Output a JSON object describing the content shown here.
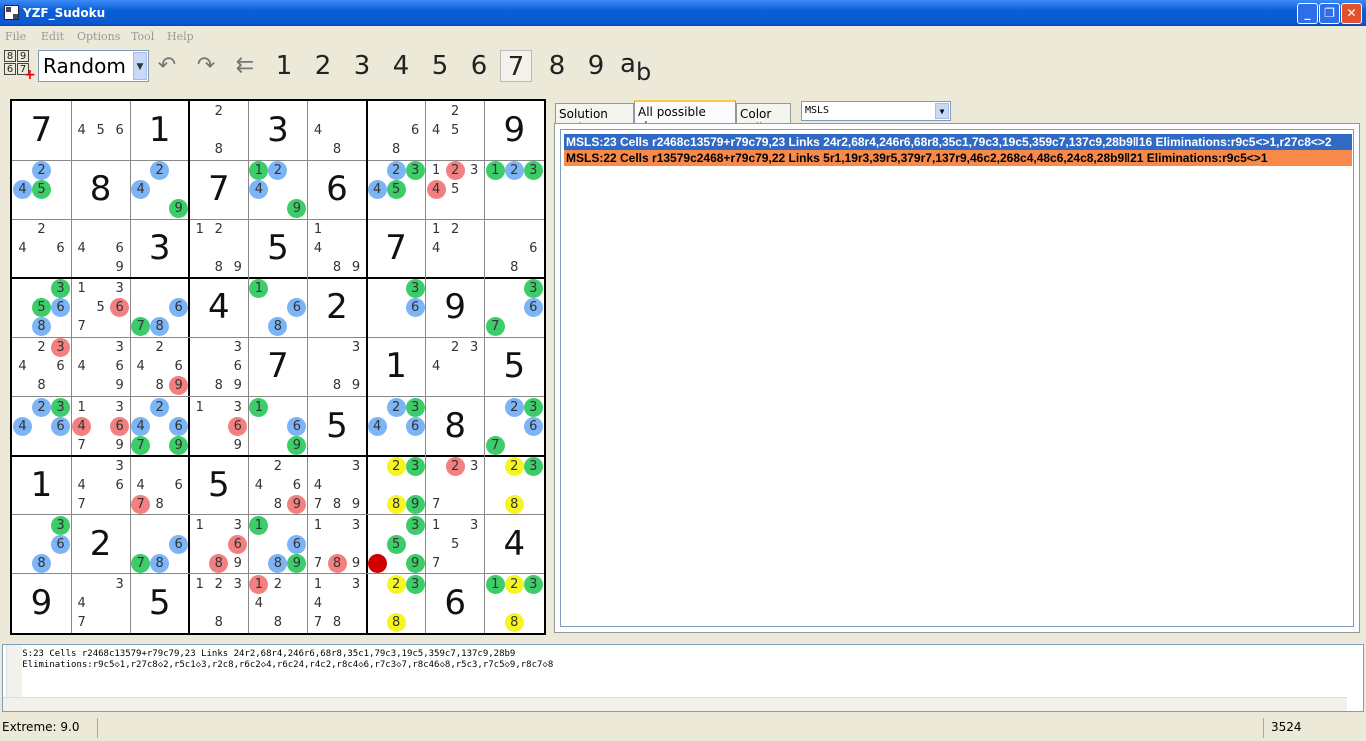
{
  "window": {
    "title": "YZF_Sudoku",
    "min_label": "_",
    "max_label": "❐",
    "close_label": "✕"
  },
  "menu": [
    "File",
    "Edit",
    "Options",
    "Tool",
    "Help"
  ],
  "toolbar": {
    "grid_icon_digits": [
      "8",
      "9",
      "6",
      "7"
    ],
    "difficulty": "Random",
    "icons": [
      "undo-icon",
      "redo-icon",
      "back-arrow-icon"
    ],
    "digits": [
      "1",
      "2",
      "3",
      "4",
      "5",
      "6",
      "7",
      "8",
      "9"
    ],
    "active_digit": "7",
    "ab_label": "a",
    "ab_sub": "b"
  },
  "colors": {
    "blue": "#7db4f5",
    "green": "#3dcc6a",
    "red": "#f28080",
    "yellow": "#f5f522",
    "dark_red": "#d00000",
    "selected_step": "#316ac5",
    "highlight_step": "#f7894a"
  },
  "tabs": [
    "Solution path",
    "All possible steps",
    "Color Cell"
  ],
  "active_tab": "All possible steps",
  "filter": "MSLS",
  "steps": [
    {
      "text": "MSLS:23 Cells r2468c13579+r79c79,23 Links 24r2,68r4,246r6,68r8,35c1,79c3,19c5,359c7,137c9,28b9ǁ16 Eliminations:r9c5<>1,r27c8<>2",
      "state": "selected"
    },
    {
      "text": "MSLS:22 Cells r13579c2468+r79c79,22 Links 5r1,19r3,39r5,379r7,137r9,46c2,268c4,48c6,24c8,28b9ǁ21 Eliminations:r9c5<>1",
      "state": "highlight"
    }
  ],
  "description": [
    "MSLS:23 Cells r2468c13579+r79c79,23 Links 24r2,68r4,246r6,68r8,35c1,79c3,19c5,359c7,137c9,28b9",
    "16 Eliminations:r9c5◇1,r27c8◇2,r5c1◇3,r2c8,r6c2◇4,r6c24,r4c2,r8c4◇6,r7c3◇7,r8c46◇8,r5c3,r7c5◇9,r8c7◇8"
  ],
  "status": {
    "left": "Extreme: 9.0",
    "right": "3524"
  },
  "board": [
    [
      {
        "v": "7"
      },
      {
        "c": [
          [
            "4",
            ""
          ],
          [
            "5",
            ""
          ],
          [
            "6",
            ""
          ]
        ]
      },
      {
        "v": "1"
      },
      {
        "c": [
          [
            "2",
            ""
          ],
          [
            "8",
            ""
          ]
        ]
      },
      {
        "v": "3"
      },
      {
        "c": [
          [
            "4",
            ""
          ],
          [
            "8",
            ""
          ]
        ]
      },
      {
        "c": [
          [
            "6",
            ""
          ],
          [
            "8",
            ""
          ]
        ]
      },
      {
        "c": [
          [
            "2",
            ""
          ],
          [
            "4",
            ""
          ],
          [
            "5",
            ""
          ]
        ]
      },
      {
        "v": "9"
      }
    ],
    [
      {
        "c": [
          [
            "2",
            "b"
          ],
          [
            "4",
            "b"
          ],
          [
            "5",
            "g"
          ]
        ]
      },
      {
        "v": "8"
      },
      {
        "c": [
          [
            "2",
            "b"
          ],
          [
            "4",
            "b"
          ],
          [
            "9",
            "g"
          ]
        ]
      },
      {
        "v": "7"
      },
      {
        "c": [
          [
            "1",
            "g"
          ],
          [
            "2",
            "b"
          ],
          [
            "4",
            "b"
          ],
          [
            "9",
            "g"
          ]
        ]
      },
      {
        "v": "6"
      },
      {
        "c": [
          [
            "2",
            "b"
          ],
          [
            "3",
            "g"
          ],
          [
            "4",
            "b"
          ],
          [
            "5",
            "g"
          ]
        ]
      },
      {
        "c": [
          [
            "1",
            ""
          ],
          [
            "2",
            "r"
          ],
          [
            "3",
            ""
          ],
          [
            "4",
            "r"
          ],
          [
            "5",
            ""
          ]
        ]
      },
      {
        "c": [
          [
            "1",
            "g"
          ],
          [
            "2",
            "b"
          ],
          [
            "3",
            "g"
          ]
        ]
      }
    ],
    [
      {
        "c": [
          [
            "2",
            ""
          ],
          [
            "4",
            ""
          ],
          [
            "6",
            ""
          ]
        ]
      },
      {
        "c": [
          [
            "4",
            ""
          ],
          [
            "6",
            ""
          ],
          [
            "9",
            ""
          ]
        ]
      },
      {
        "v": "3"
      },
      {
        "c": [
          [
            "1",
            ""
          ],
          [
            "2",
            ""
          ],
          [
            "8",
            ""
          ],
          [
            "9",
            ""
          ]
        ]
      },
      {
        "v": "5"
      },
      {
        "c": [
          [
            "1",
            ""
          ],
          [
            "4",
            ""
          ],
          [
            "8",
            ""
          ],
          [
            "9",
            ""
          ]
        ]
      },
      {
        "v": "7"
      },
      {
        "c": [
          [
            "1",
            ""
          ],
          [
            "2",
            ""
          ],
          [
            "4",
            ""
          ]
        ]
      },
      {
        "c": [
          [
            "6",
            ""
          ],
          [
            "8",
            ""
          ]
        ]
      }
    ],
    [
      {
        "c": [
          [
            "3",
            "g"
          ],
          [
            "5",
            "g"
          ],
          [
            "6",
            "b"
          ],
          [
            "8",
            "b"
          ]
        ]
      },
      {
        "c": [
          [
            "1",
            ""
          ],
          [
            "3",
            ""
          ],
          [
            "5",
            ""
          ],
          [
            "6",
            "r"
          ],
          [
            "7",
            ""
          ]
        ]
      },
      {
        "c": [
          [
            "6",
            "b"
          ],
          [
            "7",
            "g"
          ],
          [
            "8",
            "b"
          ]
        ]
      },
      {
        "v": "4"
      },
      {
        "c": [
          [
            "1",
            "g"
          ],
          [
            "6",
            "b"
          ],
          [
            "8",
            "b"
          ]
        ]
      },
      {
        "v": "2"
      },
      {
        "c": [
          [
            "3",
            "g"
          ],
          [
            "6",
            "b"
          ]
        ]
      },
      {
        "v": "9"
      },
      {
        "c": [
          [
            "3",
            "g"
          ],
          [
            "6",
            "b"
          ],
          [
            "7",
            "g"
          ]
        ]
      }
    ],
    [
      {
        "c": [
          [
            "2",
            ""
          ],
          [
            "3",
            "r"
          ],
          [
            "4",
            ""
          ],
          [
            "6",
            ""
          ],
          [
            "8",
            ""
          ]
        ]
      },
      {
        "c": [
          [
            "3",
            ""
          ],
          [
            "4",
            ""
          ],
          [
            "6",
            ""
          ],
          [
            "9",
            ""
          ]
        ]
      },
      {
        "c": [
          [
            "2",
            ""
          ],
          [
            "4",
            ""
          ],
          [
            "6",
            ""
          ],
          [
            "8",
            ""
          ],
          [
            "9",
            "r"
          ]
        ]
      },
      {
        "c": [
          [
            "3",
            ""
          ],
          [
            "6",
            ""
          ],
          [
            "8",
            ""
          ],
          [
            "9",
            ""
          ]
        ]
      },
      {
        "v": "7"
      },
      {
        "c": [
          [
            "3",
            ""
          ],
          [
            "8",
            ""
          ],
          [
            "9",
            ""
          ]
        ]
      },
      {
        "v": "1"
      },
      {
        "c": [
          [
            "2",
            ""
          ],
          [
            "3",
            ""
          ],
          [
            "4",
            ""
          ]
        ]
      },
      {
        "v": "5"
      }
    ],
    [
      {
        "c": [
          [
            "2",
            "b"
          ],
          [
            "3",
            "g"
          ],
          [
            "4",
            "b"
          ],
          [
            "6",
            "b"
          ]
        ]
      },
      {
        "c": [
          [
            "1",
            ""
          ],
          [
            "3",
            ""
          ],
          [
            "4",
            "r"
          ],
          [
            "6",
            "r"
          ],
          [
            "7",
            ""
          ],
          [
            "9",
            ""
          ]
        ]
      },
      {
        "c": [
          [
            "2",
            "b"
          ],
          [
            "4",
            "b"
          ],
          [
            "6",
            "b"
          ],
          [
            "7",
            "g"
          ],
          [
            "9",
            "g"
          ]
        ]
      },
      {
        "c": [
          [
            "1",
            ""
          ],
          [
            "3",
            ""
          ],
          [
            "6",
            "r"
          ],
          [
            "9",
            ""
          ]
        ]
      },
      {
        "c": [
          [
            "1",
            "g"
          ],
          [
            "6",
            "b"
          ],
          [
            "9",
            "g"
          ]
        ]
      },
      {
        "v": "5"
      },
      {
        "c": [
          [
            "2",
            "b"
          ],
          [
            "3",
            "g"
          ],
          [
            "4",
            "b"
          ],
          [
            "6",
            "b"
          ]
        ]
      },
      {
        "v": "8"
      },
      {
        "c": [
          [
            "2",
            "b"
          ],
          [
            "3",
            "g"
          ],
          [
            "6",
            "b"
          ],
          [
            "7",
            "g"
          ]
        ]
      }
    ],
    [
      {
        "v": "1"
      },
      {
        "c": [
          [
            "3",
            ""
          ],
          [
            "4",
            ""
          ],
          [
            "6",
            ""
          ],
          [
            "7",
            ""
          ]
        ]
      },
      {
        "c": [
          [
            "4",
            ""
          ],
          [
            "6",
            ""
          ],
          [
            "7",
            "r"
          ],
          [
            "8",
            ""
          ]
        ]
      },
      {
        "v": "5"
      },
      {
        "c": [
          [
            "2",
            ""
          ],
          [
            "4",
            ""
          ],
          [
            "6",
            ""
          ],
          [
            "8",
            ""
          ],
          [
            "9",
            "r"
          ]
        ]
      },
      {
        "c": [
          [
            "3",
            ""
          ],
          [
            "4",
            ""
          ],
          [
            "7",
            ""
          ],
          [
            "8",
            ""
          ],
          [
            "9",
            ""
          ]
        ]
      },
      {
        "c": [
          [
            "2",
            "y"
          ],
          [
            "3",
            "g"
          ],
          [
            "8",
            "y"
          ],
          [
            "9",
            "g"
          ]
        ]
      },
      {
        "c": [
          [
            "2",
            "r"
          ],
          [
            "3",
            ""
          ],
          [
            "7",
            ""
          ]
        ]
      },
      {
        "c": [
          [
            "2",
            "y"
          ],
          [
            "3",
            "g"
          ],
          [
            "8",
            "y"
          ]
        ]
      }
    ],
    [
      {
        "c": [
          [
            "3",
            "g"
          ],
          [
            "6",
            "b"
          ],
          [
            "8",
            "b"
          ]
        ]
      },
      {
        "v": "2"
      },
      {
        "c": [
          [
            "6",
            "b"
          ],
          [
            "7",
            "g"
          ],
          [
            "8",
            "b"
          ]
        ]
      },
      {
        "c": [
          [
            "1",
            ""
          ],
          [
            "3",
            ""
          ],
          [
            "6",
            "r"
          ],
          [
            "8",
            "r"
          ],
          [
            "9",
            ""
          ]
        ]
      },
      {
        "c": [
          [
            "1",
            "g"
          ],
          [
            "6",
            "b"
          ],
          [
            "8",
            "b"
          ],
          [
            "9",
            "g"
          ]
        ]
      },
      {
        "c": [
          [
            "1",
            ""
          ],
          [
            "3",
            ""
          ],
          [
            "7",
            ""
          ],
          [
            "8",
            "r"
          ],
          [
            "9",
            ""
          ]
        ]
      },
      {
        "c": [
          [
            "3",
            "g"
          ],
          [
            "5",
            "g"
          ],
          [
            "7",
            "d"
          ],
          [
            "9",
            "g"
          ]
        ]
      },
      {
        "c": [
          [
            "1",
            ""
          ],
          [
            "3",
            ""
          ],
          [
            "5",
            ""
          ],
          [
            "7",
            ""
          ]
        ]
      },
      {
        "v": "4"
      }
    ],
    [
      {
        "v": "9"
      },
      {
        "c": [
          [
            "3",
            ""
          ],
          [
            "4",
            ""
          ],
          [
            "7",
            ""
          ]
        ]
      },
      {
        "v": "5"
      },
      {
        "c": [
          [
            "1",
            ""
          ],
          [
            "2",
            ""
          ],
          [
            "3",
            ""
          ],
          [
            "8",
            ""
          ]
        ]
      },
      {
        "c": [
          [
            "1",
            "r"
          ],
          [
            "2",
            ""
          ],
          [
            "4",
            ""
          ],
          [
            "8",
            ""
          ]
        ]
      },
      {
        "c": [
          [
            "1",
            ""
          ],
          [
            "3",
            ""
          ],
          [
            "4",
            ""
          ],
          [
            "7",
            ""
          ],
          [
            "8",
            ""
          ]
        ]
      },
      {
        "c": [
          [
            "2",
            "y"
          ],
          [
            "3",
            "g"
          ],
          [
            "8",
            "y"
          ]
        ]
      },
      {
        "v": "6"
      },
      {
        "c": [
          [
            "1",
            "g"
          ],
          [
            "2",
            "y"
          ],
          [
            "3",
            "g"
          ],
          [
            "8",
            "y"
          ]
        ]
      }
    ]
  ]
}
